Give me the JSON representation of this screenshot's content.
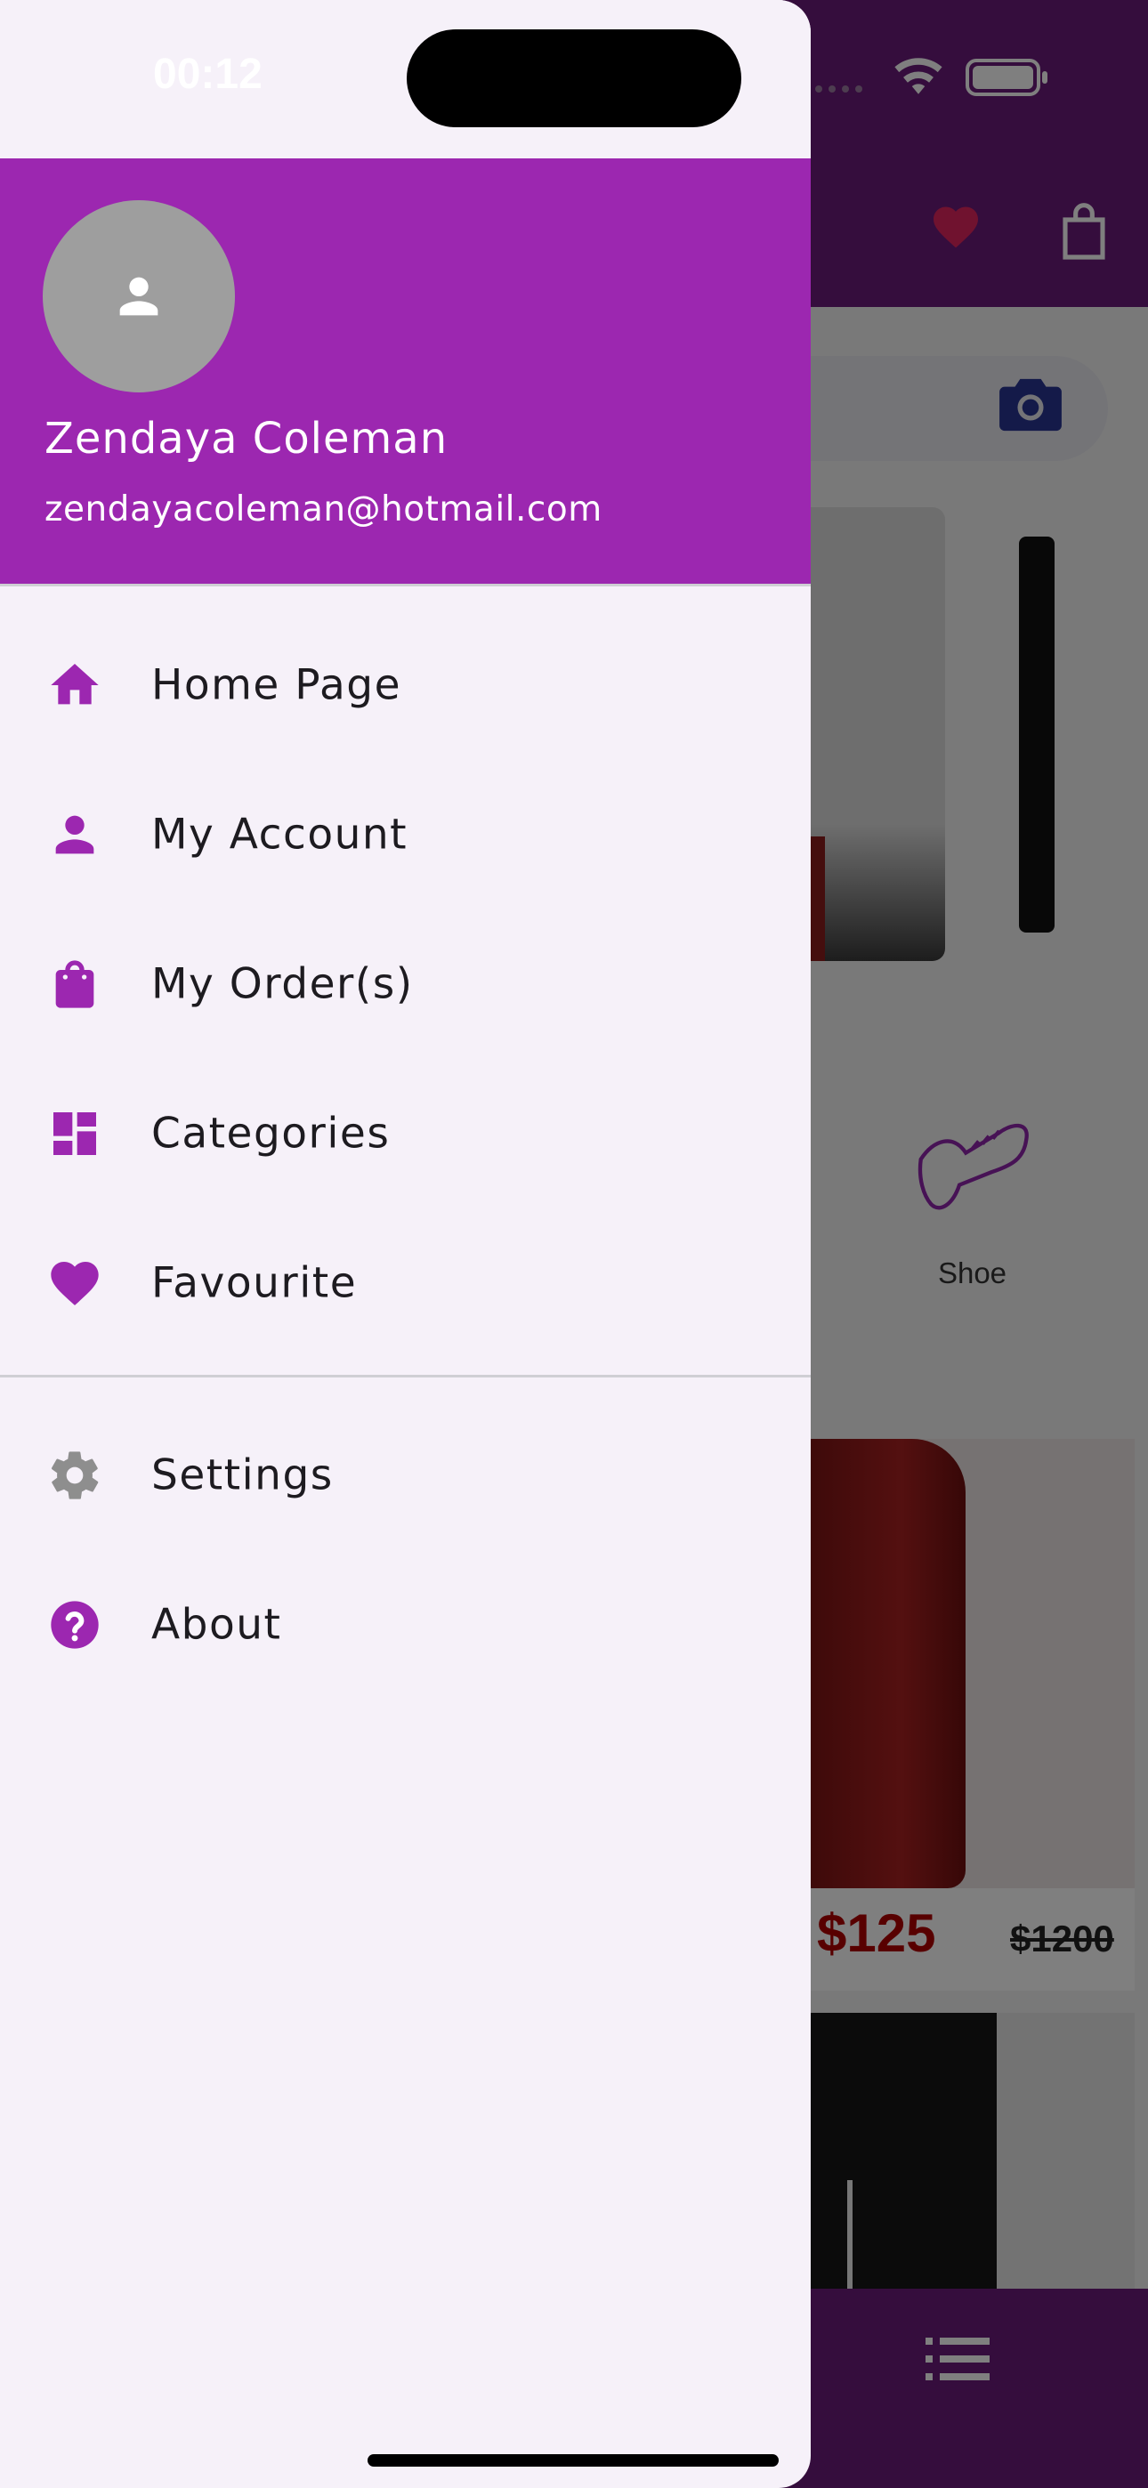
{
  "status_bar": {
    "time": "00:12"
  },
  "drawer": {
    "user": {
      "name": "Zendaya Coleman",
      "email": "zendayacoleman@hotmail.com"
    },
    "menu": [
      {
        "label": "Home Page",
        "icon": "home-icon"
      },
      {
        "label": "My Account",
        "icon": "person-icon"
      },
      {
        "label": "My Order(s)",
        "icon": "shopping-bag-icon"
      },
      {
        "label": "Categories",
        "icon": "dashboard-icon"
      },
      {
        "label": "Favourite",
        "icon": "heart-icon"
      }
    ],
    "secondary_menu": [
      {
        "label": "Settings",
        "icon": "gear-icon"
      },
      {
        "label": "About",
        "icon": "help-icon"
      }
    ]
  },
  "background": {
    "category_label": "Shoe",
    "price": "$125",
    "old_price": "$1200"
  },
  "colors": {
    "accent": "#9c27b0",
    "appbar": "#6a1b7a",
    "drawer_bg": "#f6f1f9",
    "price": "#b00000"
  }
}
